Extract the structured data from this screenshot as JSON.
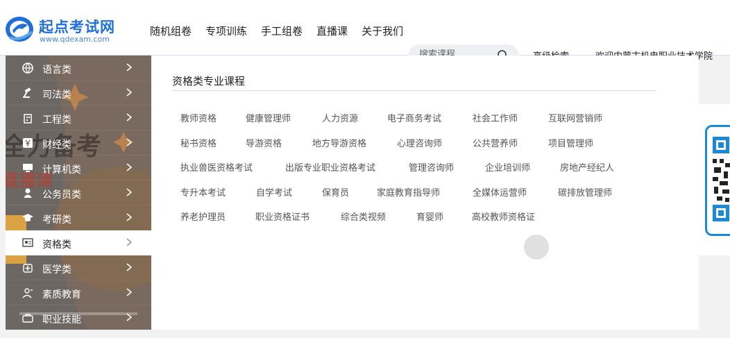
{
  "brand": {
    "title": "起点考试网",
    "url": "www.qdexam.com"
  },
  "nav": [
    "随机组卷",
    "专项训练",
    "手工组卷",
    "直播课",
    "关于我们"
  ],
  "search": {
    "placeholder": "搜索课程"
  },
  "header_links": {
    "advanced": "高级检索",
    "welcome": "欢迎内蒙古机电职业技术学院"
  },
  "sidebar": [
    {
      "label": "语言类",
      "icon": "globe-icon"
    },
    {
      "label": "司法类",
      "icon": "gavel-icon"
    },
    {
      "label": "工程类",
      "icon": "building-icon"
    },
    {
      "label": "财经类",
      "icon": "yen-icon"
    },
    {
      "label": "计算机类",
      "icon": "computer-icon"
    },
    {
      "label": "公务员类",
      "icon": "user-icon"
    },
    {
      "label": "考研类",
      "icon": "graduation-cap-icon"
    },
    {
      "label": "资格类",
      "icon": "certificate-icon",
      "active": true
    },
    {
      "label": "医学类",
      "icon": "medical-icon"
    },
    {
      "label": "素质教育",
      "icon": "person-icon"
    },
    {
      "label": "职业技能",
      "icon": "briefcase-icon"
    }
  ],
  "panel": {
    "title": "资格类专业课程",
    "rows": [
      [
        "教师资格",
        "健康管理师",
        "人力资源",
        "电子商务考试",
        "社会工作师",
        "互联网营销师"
      ],
      [
        "秘书资格",
        "导游资格",
        "地方导游资格",
        "心理咨询师",
        "公共营养师",
        "项目管理师"
      ],
      [
        "执业兽医资格考试",
        "出版专业职业资格考试",
        "管理咨询师",
        "企业培训师",
        "房地产经纪人"
      ],
      [
        "专升本考试",
        "自学考试",
        "保育员",
        "家庭教育指导师",
        "全媒体运营师",
        "碳排放管理师"
      ],
      [
        "养老护理员",
        "职业资格证书",
        "综合类视频",
        "育婴师",
        "高校教师资格证"
      ]
    ]
  },
  "banner_text": {
    "line1": "全力备考",
    "line2": "直播课"
  },
  "colors": {
    "brand_blue": "#1f6fd6",
    "qr_blue": "#1a8ad8"
  }
}
